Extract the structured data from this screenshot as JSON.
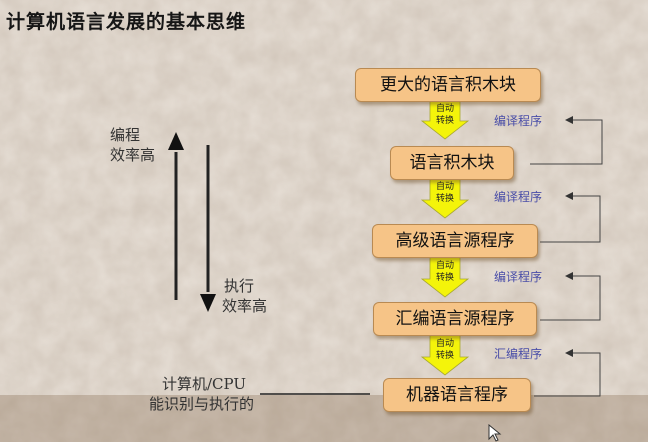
{
  "title": "计算机语言发展的基本思维",
  "boxes": [
    {
      "label": "更大的语言积木块"
    },
    {
      "label": "语言积木块"
    },
    {
      "label": "高级语言源程序"
    },
    {
      "label": "汇编语言源程序"
    },
    {
      "label": "机器语言程序"
    }
  ],
  "auto_convert": {
    "line1": "自动",
    "line2": "转换"
  },
  "side_labels": [
    "编译程序",
    "编译程序",
    "编译程序",
    "汇编程序"
  ],
  "left": {
    "prog_eff_line1": "编程",
    "prog_eff_line2": "效率高",
    "exec_eff_line1": "执行",
    "exec_eff_line2": "效率高"
  },
  "machine_note": {
    "line1": "计算机/CPU",
    "line2": "能识别与执行的"
  },
  "colors": {
    "box_fill": "#f6c487",
    "arrow_fill": "#f4f40a",
    "side_label": "#4a4ea8"
  }
}
